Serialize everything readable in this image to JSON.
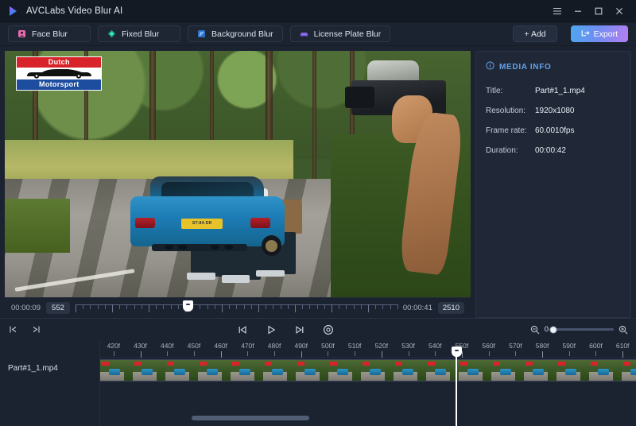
{
  "titlebar": {
    "app_title": "AVCLabs Video Blur AI",
    "logo_icon": "play-logo-icon",
    "menu_icon": "hamburger-menu-icon",
    "minimize_icon": "minimize-icon",
    "maximize_icon": "maximize-icon",
    "close_icon": "close-icon"
  },
  "toolbar": {
    "modes": [
      {
        "label": "Face Blur",
        "icon": "face-blur-icon",
        "color": "#e86bb0"
      },
      {
        "label": "Fixed Blur",
        "icon": "fixed-blur-icon",
        "color": "#25d6a8"
      },
      {
        "label": "Background Blur",
        "icon": "background-blur-icon",
        "color": "#4a90e2"
      },
      {
        "label": "License Plate Blur",
        "icon": "license-plate-blur-icon",
        "color": "#8c6cf0"
      }
    ],
    "add_label": "+ Add",
    "export_label": "Export",
    "export_icon": "export-icon",
    "export_gradient_from": "#4ca7f0",
    "export_gradient_to": "#b47ef0"
  },
  "preview": {
    "overlay_logo": {
      "top_text": "Dutch",
      "bottom_text": "Motorsport",
      "top_color": "#d8232a",
      "bottom_color": "#1d4d9e",
      "car_icon": "race-car-silhouette-icon"
    },
    "license_plate_text": "ST-84-DR"
  },
  "scrubber": {
    "start_timecode": "00:00:09",
    "start_frame": "552",
    "end_timecode": "00:00:41",
    "end_frame": "2510",
    "handle_position_pct": 35
  },
  "media_info": {
    "header": "MEDIA INFO",
    "header_icon": "info-circle-icon",
    "accent_color": "#63a2e8",
    "rows": [
      {
        "key": "Title:",
        "value": "Part#1_1.mp4"
      },
      {
        "key": "Resolution:",
        "value": "1920x1080"
      },
      {
        "key": "Frame rate:",
        "value": "60.0010fps"
      },
      {
        "key": "Duration:",
        "value": "00:00:42"
      }
    ]
  },
  "timeline": {
    "left_buttons": [
      {
        "icon": "jump-to-start-icon"
      },
      {
        "icon": "jump-to-end-icon"
      }
    ],
    "transport": [
      {
        "icon": "previous-frame-icon"
      },
      {
        "icon": "play-icon"
      },
      {
        "icon": "next-frame-icon"
      },
      {
        "icon": "snapshot-icon"
      }
    ],
    "zoom_out_icon": "zoom-out-icon",
    "zoom_in_icon": "zoom-in-icon",
    "zoom_value": "0",
    "track_name": "Part#1_1.mp4",
    "ruler_labels": [
      "420f",
      "430f",
      "440f",
      "450f",
      "460f",
      "470f",
      "480f",
      "490f",
      "500f",
      "510f",
      "520f",
      "530f",
      "540f",
      "550f",
      "560f",
      "570f",
      "580f",
      "590f",
      "600f",
      "610f"
    ],
    "playhead_frame": "552",
    "playhead_pct": 66.5,
    "scrollbar_left_pct": 17,
    "scrollbar_width_pct": 22
  }
}
